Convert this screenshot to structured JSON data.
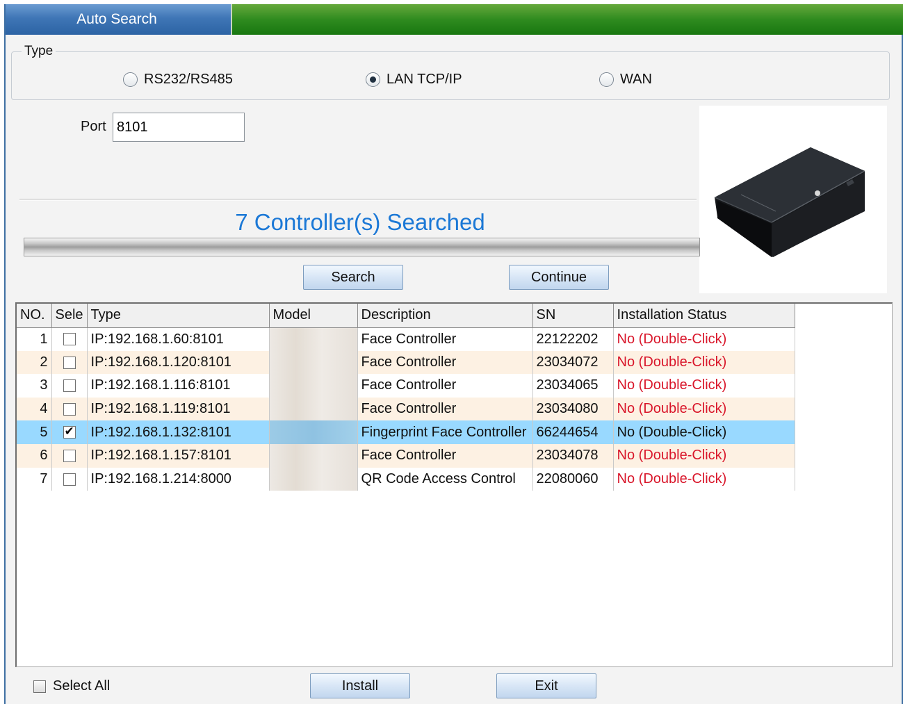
{
  "window": {
    "title": "Auto Search"
  },
  "type_group": {
    "legend": "Type",
    "options": [
      {
        "label": "RS232/RS485",
        "selected": false
      },
      {
        "label": "LAN TCP/IP",
        "selected": true
      },
      {
        "label": "WAN",
        "selected": false
      }
    ]
  },
  "port": {
    "label": "Port",
    "value": "8101"
  },
  "search_status": "7 Controller(s) Searched",
  "buttons": {
    "search": "Search",
    "continue": "Continue",
    "install": "Install",
    "exit": "Exit"
  },
  "table": {
    "columns": [
      "NO.",
      "Sele",
      "Type",
      "Model",
      "Description",
      "SN",
      "Installation Status"
    ],
    "rows": [
      {
        "no": "1",
        "checked": false,
        "type": "IP:192.168.1.60:8101",
        "model": "",
        "description": "Face Controller",
        "sn": "22122202",
        "status": "No (Double-Click)"
      },
      {
        "no": "2",
        "checked": false,
        "type": "IP:192.168.1.120:8101",
        "model": "",
        "description": "Face Controller",
        "sn": "23034072",
        "status": "No (Double-Click)"
      },
      {
        "no": "3",
        "checked": false,
        "type": "IP:192.168.1.116:8101",
        "model": "",
        "description": "Face Controller",
        "sn": "23034065",
        "status": "No (Double-Click)"
      },
      {
        "no": "4",
        "checked": false,
        "type": "IP:192.168.1.119:8101",
        "model": "",
        "description": "Face Controller",
        "sn": "23034080",
        "status": "No (Double-Click)"
      },
      {
        "no": "5",
        "checked": true,
        "type": "IP:192.168.1.132:8101",
        "model": "",
        "description": "Fingerprint Face Controller",
        "sn": "66244654",
        "status": "No (Double-Click)",
        "selected": true
      },
      {
        "no": "6",
        "checked": false,
        "type": "IP:192.168.1.157:8101",
        "model": "",
        "description": "Face Controller",
        "sn": "23034078",
        "status": "No (Double-Click)"
      },
      {
        "no": "7",
        "checked": false,
        "type": "IP:192.168.1.214:8000",
        "model": "",
        "description": "QR Code Access Control",
        "sn": "22080060",
        "status": "No (Double-Click)"
      }
    ]
  },
  "select_all": {
    "label": "Select All",
    "checked": false
  },
  "colors": {
    "accent_blue": "#1b78d6",
    "status_red": "#d9162a",
    "row_selected": "#99d9ff",
    "row_alt": "#fdf1e3",
    "title_green": "#2f8b1f",
    "title_blue": "#3f76b6"
  }
}
